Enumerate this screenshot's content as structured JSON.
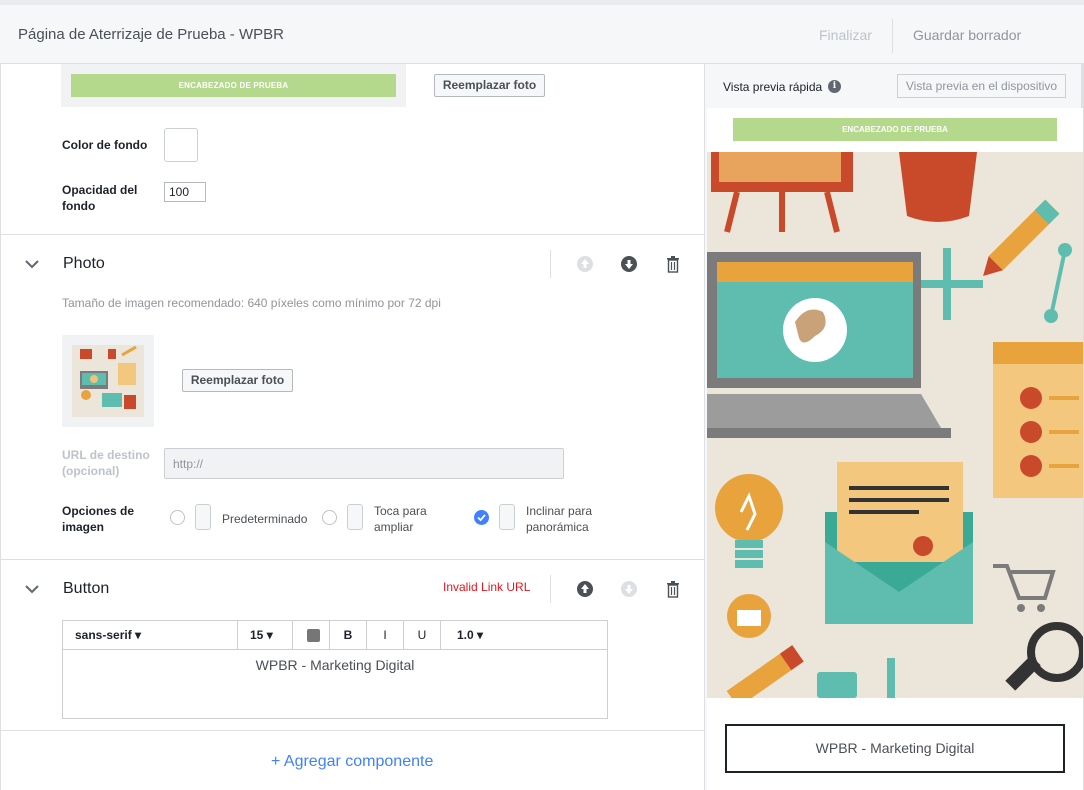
{
  "topbar": {
    "title": "Página de Aterrizaje de Prueba - WPBR",
    "finish_label": "Finalizar",
    "draft_label": "Guardar borrador"
  },
  "header_section": {
    "header_text": "ENCABEZADO DE PRUEBA",
    "replace_photo_label": "Reemplazar foto",
    "bg_color_label": "Color de fondo",
    "bg_opacity_label": "Opacidad del fondo",
    "bg_opacity_value": "100"
  },
  "photo_section": {
    "title": "Photo",
    "help_text": "Tamaño de imagen recomendado: 640 píxeles como mínimo por 72 dpi",
    "replace_photo_label": "Reemplazar foto",
    "dest_url_label": "URL de destino (opcional)",
    "dest_url_placeholder": "http://",
    "image_options_label": "Opciones de imagen",
    "options": [
      {
        "label": "Predeterminado",
        "selected": false
      },
      {
        "label": "Toca para ampliar",
        "selected": false
      },
      {
        "label": "Inclinar para panorámica",
        "selected": true
      }
    ]
  },
  "button_section": {
    "title": "Button",
    "error_text": "Invalid Link URL",
    "toolbar": {
      "font": "sans-serif",
      "size": "15",
      "bold": "B",
      "italic": "I",
      "underline": "U",
      "line_height": "1.0"
    },
    "editor_text": "WPBR - Marketing Digital"
  },
  "add_component_label": "+ Agregar componente",
  "preview": {
    "label": "Vista previa rápida",
    "device_button": "Vista previa en el dispositivo",
    "header_text": "ENCABEZADO DE PRUEBA",
    "button_text": "WPBR - Marketing Digital"
  },
  "colors": {
    "accent": "#4080ff",
    "header_green": "#b5d98c",
    "error": "#e0161f"
  }
}
